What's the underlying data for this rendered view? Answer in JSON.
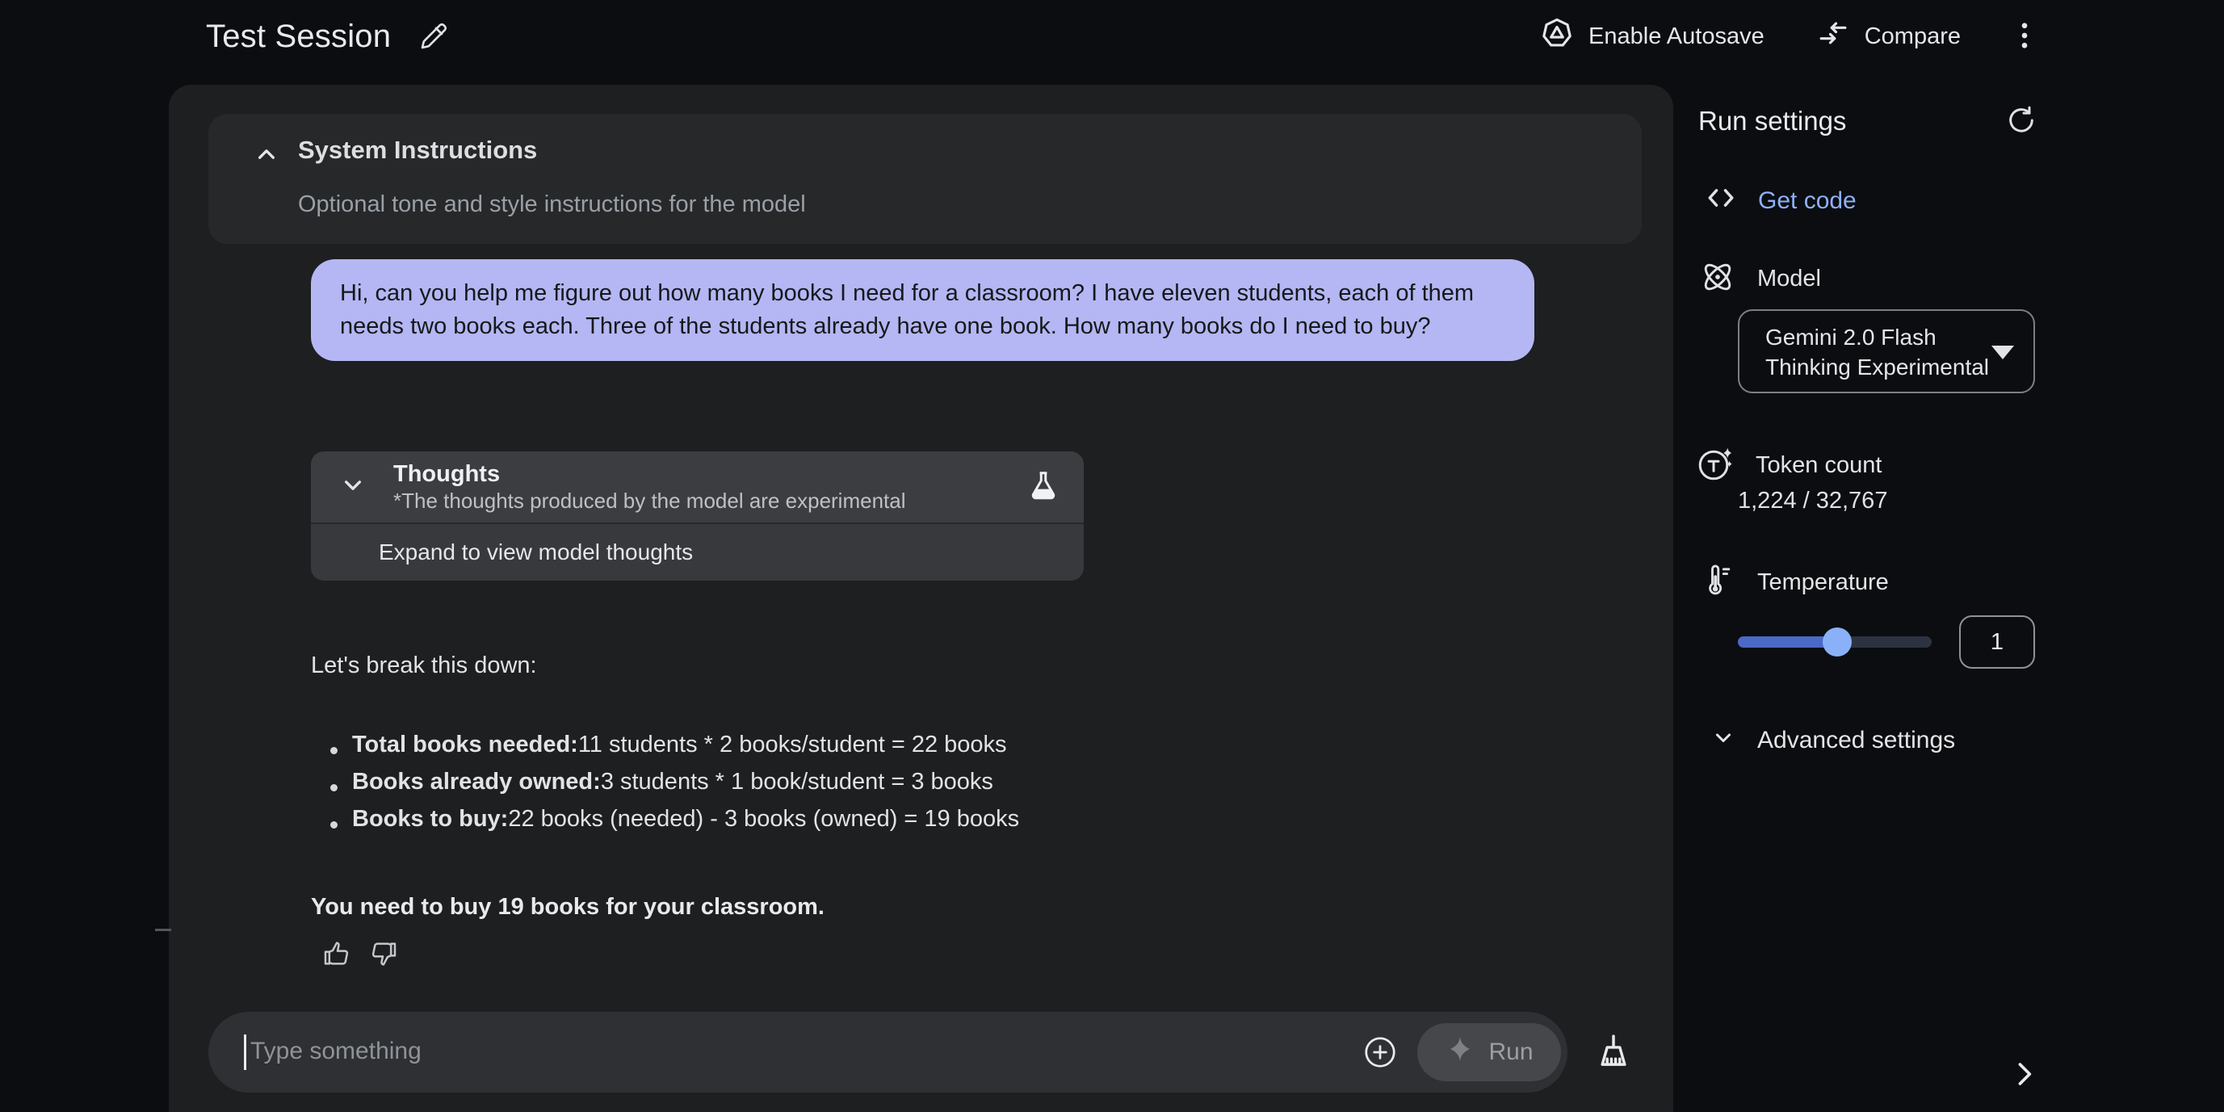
{
  "header": {
    "title": "Test Session",
    "autosave_label": "Enable Autosave",
    "compare_label": "Compare"
  },
  "system_instructions": {
    "title": "System Instructions",
    "placeholder": "Optional tone and style instructions for the model"
  },
  "chat": {
    "user_message": "Hi, can you help me figure out how many books I need for a classroom? I have eleven students, each of them needs two books each. Three of the students already have one book. How many books do I need to buy?",
    "thoughts": {
      "title": "Thoughts",
      "disclaimer": "*The thoughts produced by the model are experimental",
      "expand_label": "Expand to view model thoughts"
    },
    "response": {
      "intro": "Let's break this down:",
      "bullets": [
        {
          "bold": "Total books needed:",
          "rest": " 11 students * 2 books/student = 22 books"
        },
        {
          "bold": "Books already owned:",
          "rest": " 3 students * 1 book/student = 3 books"
        },
        {
          "bold": "Books to buy:",
          "rest": " 22 books (needed) - 3 books (owned) = 19 books"
        }
      ],
      "conclusion": "You need to buy 19 books for your classroom."
    }
  },
  "composer": {
    "placeholder": "Type something",
    "run_label": "Run"
  },
  "run_settings": {
    "title": "Run settings",
    "get_code_label": "Get code",
    "model_label": "Model",
    "model_value_line1": "Gemini 2.0 Flash",
    "model_value_line2": "Thinking Experimental",
    "token_count_label": "Token count",
    "token_count_value": "1,224 / 32,767",
    "temperature_label": "Temperature",
    "temperature_value": "1",
    "advanced_label": "Advanced settings"
  },
  "colors": {
    "accent_blue": "#8fb1f8",
    "user_bubble": "#b4b7f3",
    "slider_fill": "#4b69c6",
    "slider_thumb": "#8ab1f7",
    "card_bg": "#1d1f21",
    "page_bg": "#0b0d10"
  }
}
